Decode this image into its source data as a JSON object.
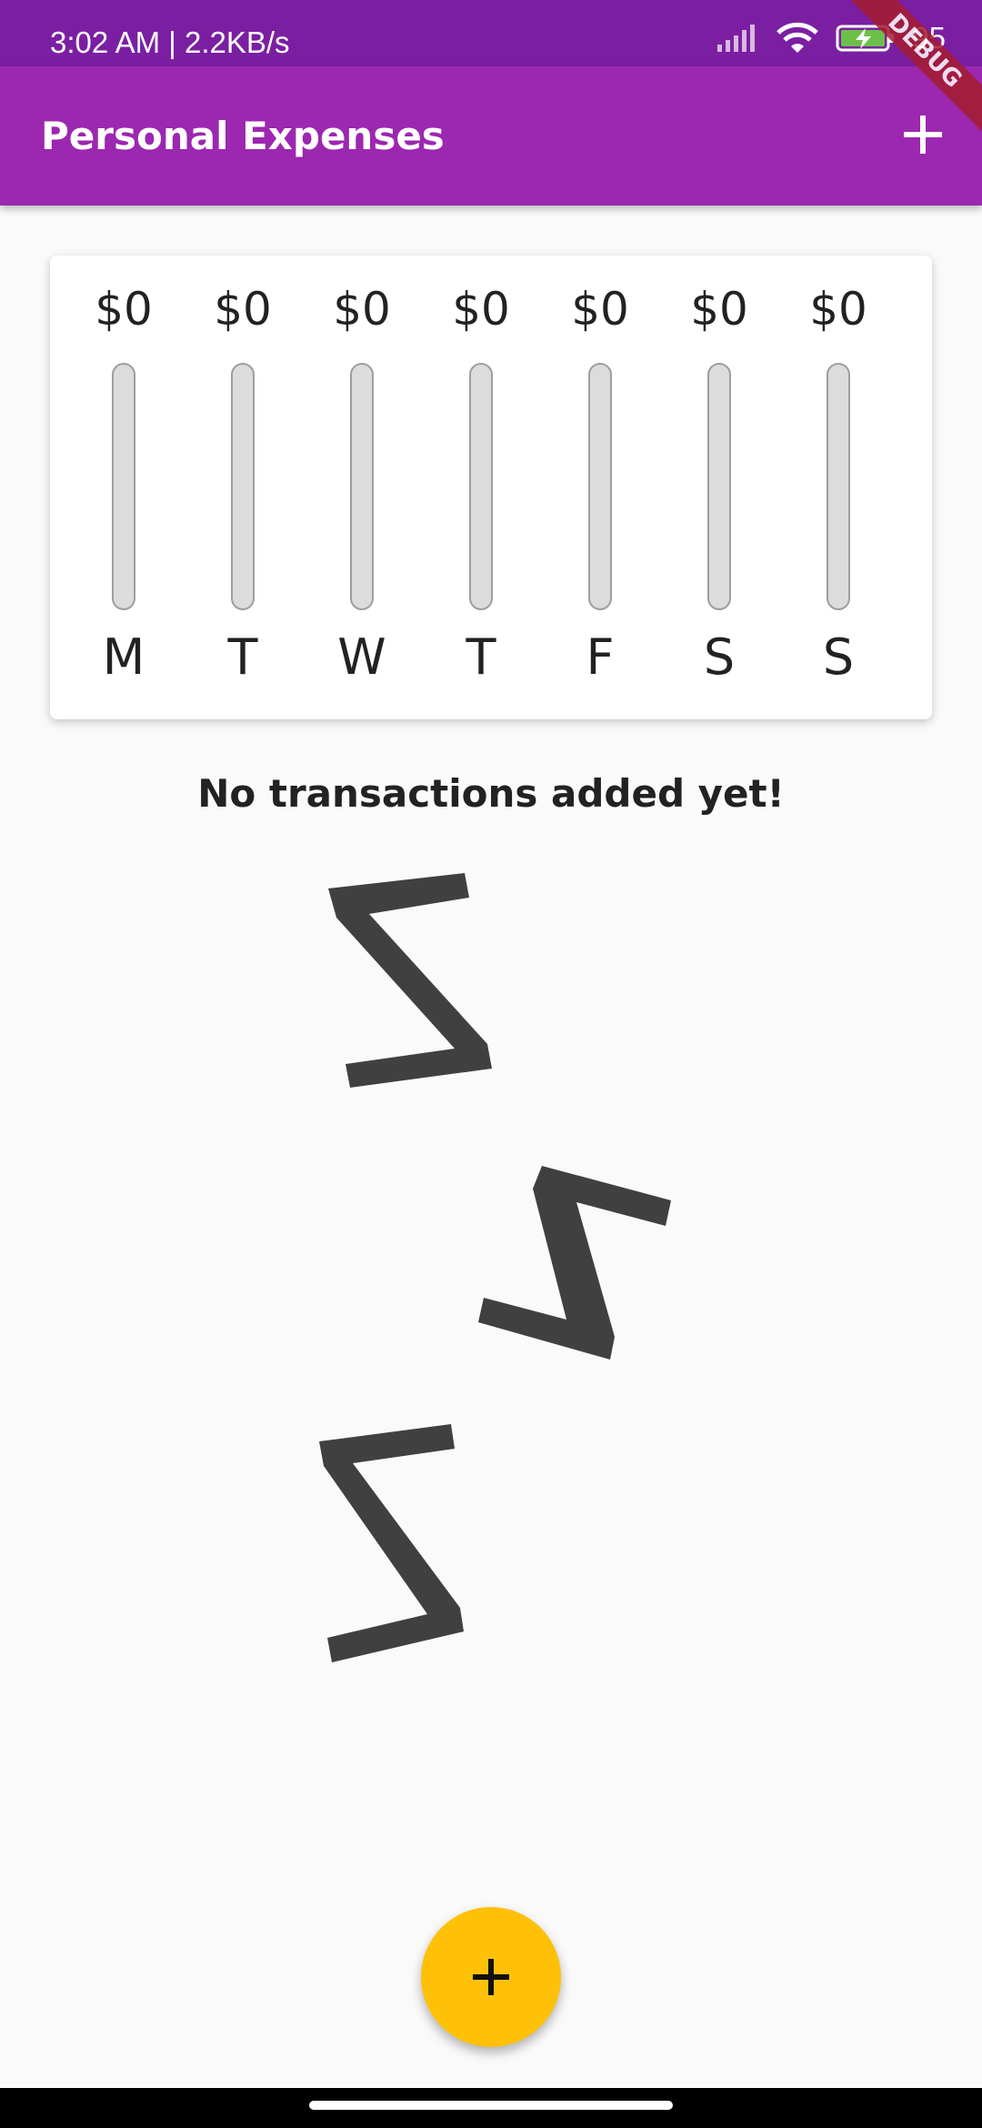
{
  "status_bar": {
    "time_speed": "3:02 AM | 2.2KB/s",
    "battery": "95"
  },
  "debug_banner": "DEBUG",
  "app_bar": {
    "title": "Personal Expenses",
    "add_icon": "plus-icon"
  },
  "chart": {
    "bars": [
      {
        "amount": "$0",
        "day": "M",
        "fill_fraction": 0
      },
      {
        "amount": "$0",
        "day": "T",
        "fill_fraction": 0
      },
      {
        "amount": "$0",
        "day": "W",
        "fill_fraction": 0
      },
      {
        "amount": "$0",
        "day": "T",
        "fill_fraction": 0
      },
      {
        "amount": "$0",
        "day": "F",
        "fill_fraction": 0
      },
      {
        "amount": "$0",
        "day": "S",
        "fill_fraction": 0
      },
      {
        "amount": "$0",
        "day": "S",
        "fill_fraction": 0
      }
    ]
  },
  "empty_state": {
    "message": "No transactions added yet!",
    "illustration": "sleeping-zzz"
  },
  "fab": {
    "icon": "plus-icon"
  },
  "colors": {
    "primary": "#9c27b0",
    "primary_dark": "#7b1fa2",
    "accent": "#ffc107"
  }
}
